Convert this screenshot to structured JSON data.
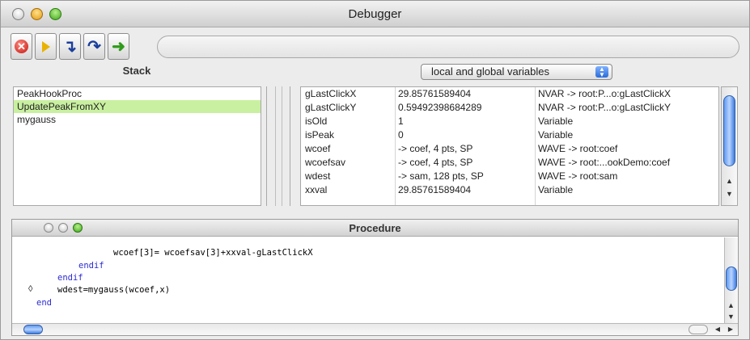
{
  "window": {
    "title": "Debugger"
  },
  "toolbar": {
    "buttons": [
      {
        "name": "stop-button",
        "icon": "stop-icon",
        "glyph": "✕"
      },
      {
        "name": "go-button",
        "icon": "go-icon"
      },
      {
        "name": "step-into-button",
        "icon": "step-into-icon",
        "glyph": "↴"
      },
      {
        "name": "step-over-button",
        "icon": "step-over-icon",
        "glyph": "↷"
      },
      {
        "name": "step-out-button",
        "icon": "step-out-icon",
        "glyph": "➜"
      }
    ]
  },
  "stack": {
    "header": "Stack",
    "items": [
      "PeakHookProc",
      "UpdatePeakFromXY",
      "mygauss"
    ],
    "selected_index": 1
  },
  "variables": {
    "scope_popup": "local and global variables",
    "rows": [
      {
        "name": "gLastClickX",
        "value": "29.85761589404",
        "type": "NVAR -> root:P...o:gLastClickX"
      },
      {
        "name": "gLastClickY",
        "value": "0.59492398684289",
        "type": "NVAR -> root:P...o:gLastClickY"
      },
      {
        "name": "isOld",
        "value": "1",
        "type": "Variable"
      },
      {
        "name": "isPeak",
        "value": "0",
        "type": "Variable"
      },
      {
        "name": "wcoef",
        "value": "-> coef, 4 pts, SP",
        "type": "WAVE -> root:coef"
      },
      {
        "name": "wcoefsav",
        "value": "-> coef, 4 pts, SP",
        "type": "WAVE -> root:...ookDemo:coef"
      },
      {
        "name": "wdest",
        "value": "-> sam, 128 pts, SP",
        "type": "WAVE -> root:sam"
      },
      {
        "name": "xxval",
        "value": "29.85761589404",
        "type": "Variable"
      }
    ]
  },
  "procedure": {
    "title": "Procedure",
    "lines": [
      {
        "text": "wcoef[3]= wcoefsav[3]+xxval-gLastClickX",
        "kind": "code"
      },
      {
        "text": "endif",
        "kind": "keyword"
      },
      {
        "text": "endif",
        "kind": "keyword"
      },
      {
        "text": "wdest=mygauss(wcoef,x)",
        "kind": "code",
        "marker": "◊"
      },
      {
        "text": "end",
        "kind": "keyword"
      }
    ]
  },
  "colors": {
    "selected_row": "#c9f0a0",
    "keyword": "#2a2ad0",
    "scroll_thumb": "#5f9af0"
  }
}
